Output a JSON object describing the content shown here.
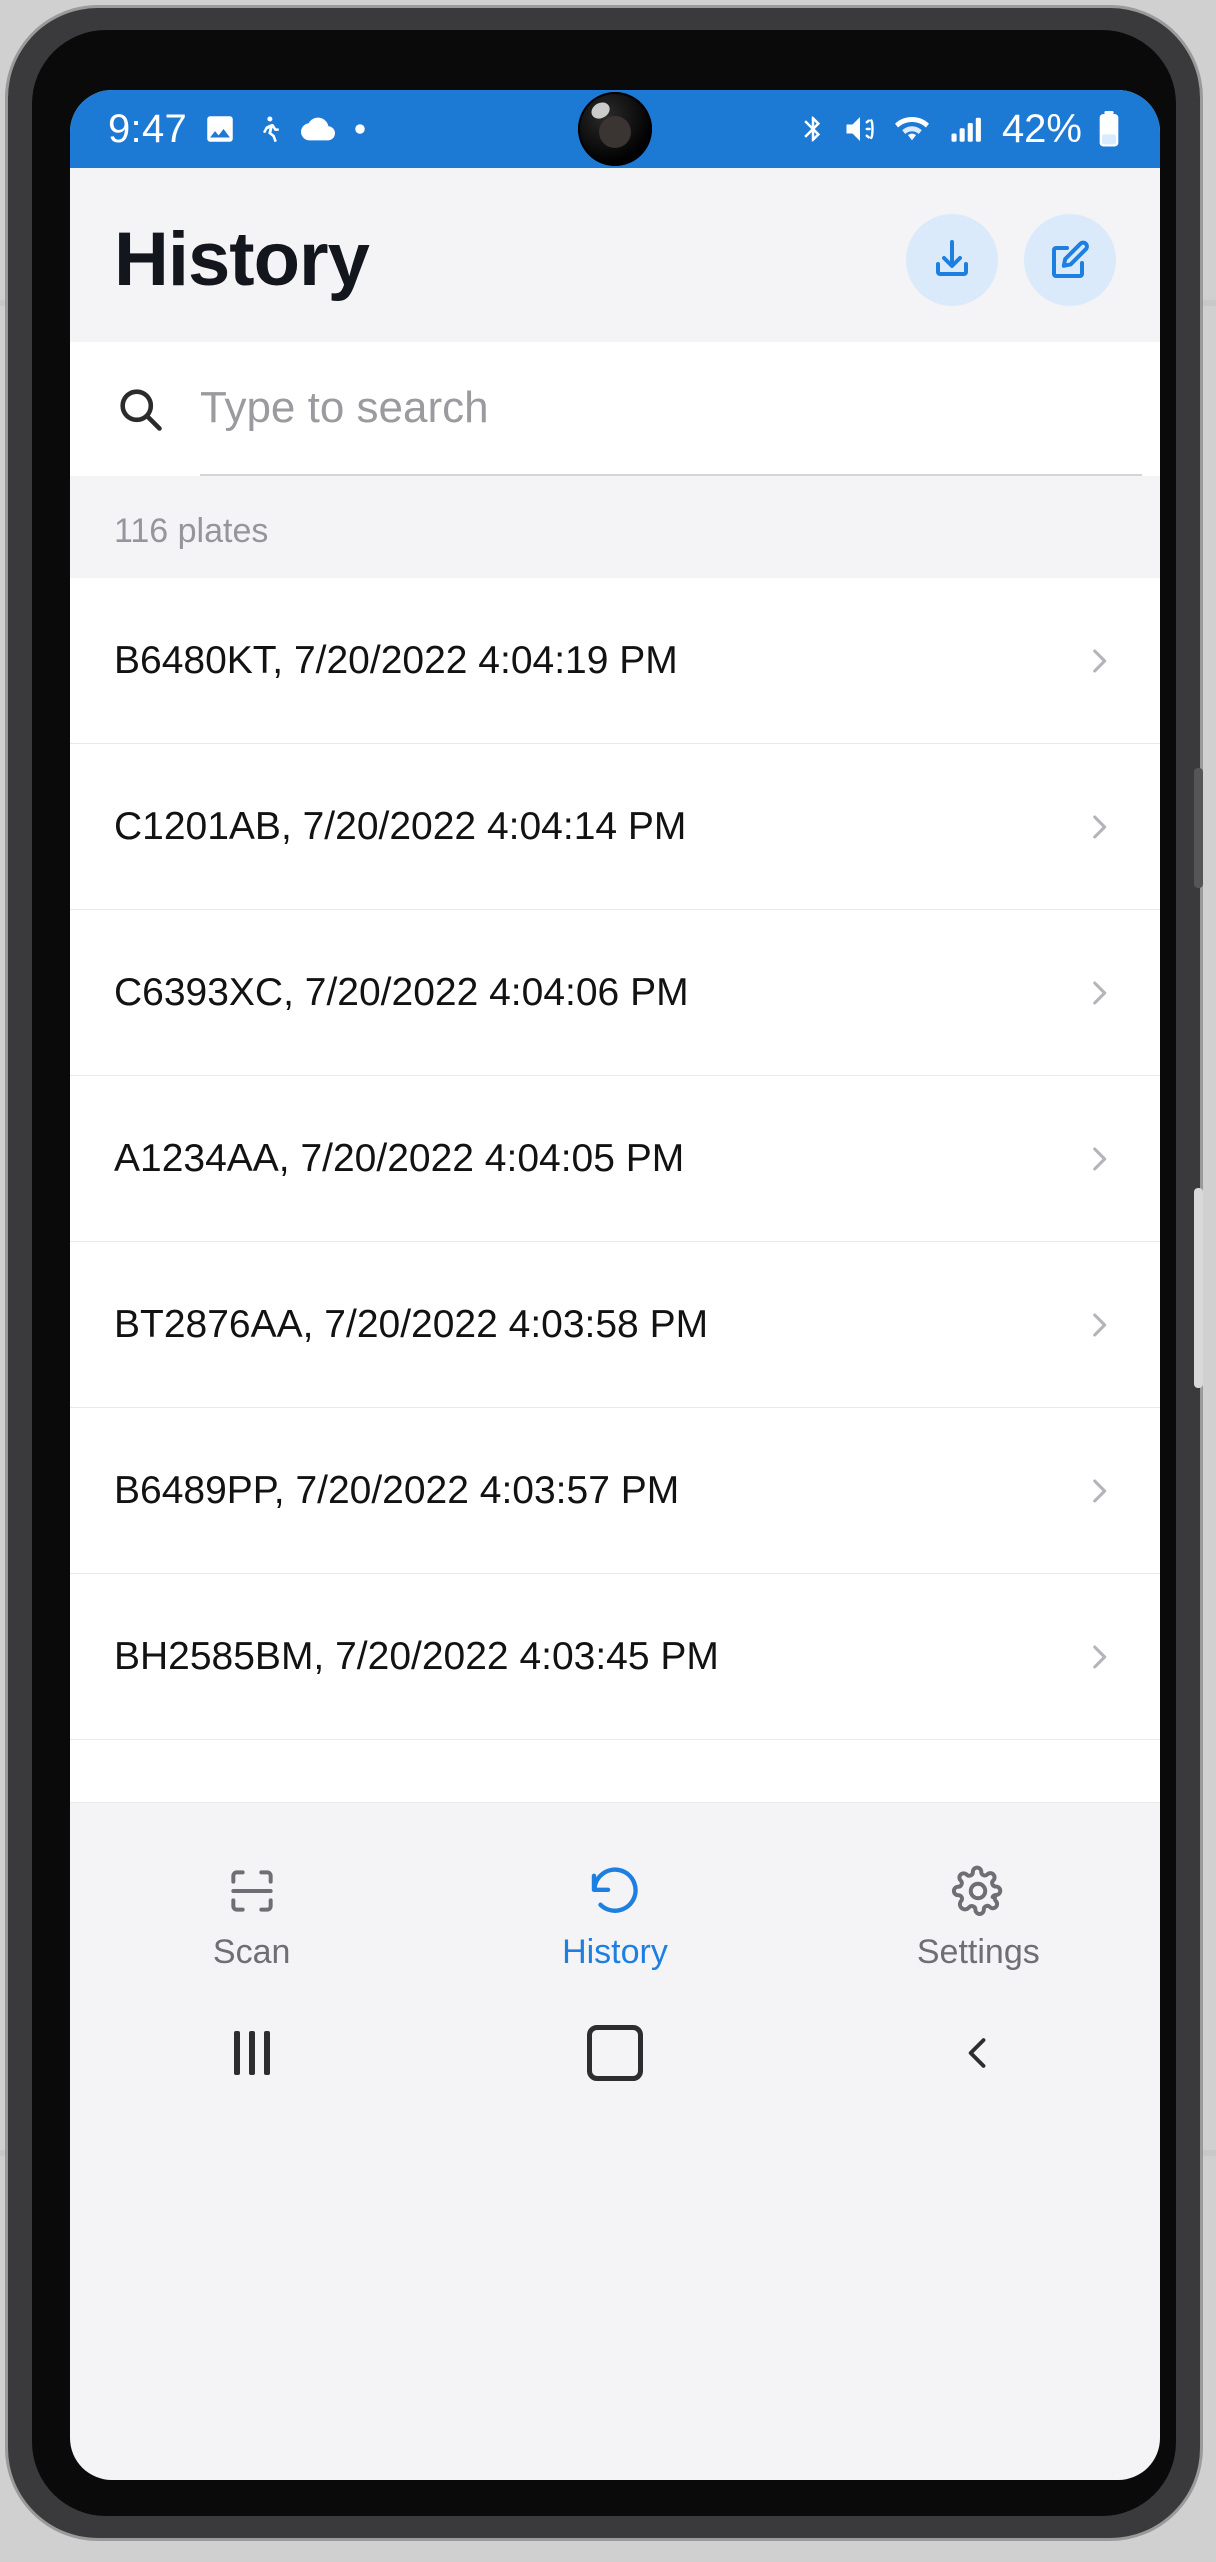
{
  "statusbar": {
    "time": "9:47",
    "battery_percent": "42%",
    "left_icons": [
      "photo-icon",
      "running-person-icon",
      "cloud-icon",
      "dot-icon"
    ],
    "right_icons": [
      "bluetooth-icon",
      "volume-mute-icon",
      "wifi-icon",
      "cellular-signal-icon",
      "battery-icon"
    ],
    "background": "#1c79d4"
  },
  "header": {
    "title": "History",
    "actions": [
      {
        "name": "download-button",
        "icon": "download-icon"
      },
      {
        "name": "edit-button",
        "icon": "edit-icon"
      }
    ],
    "accent": "#1d7fe0",
    "action_bg": "#dbeafb"
  },
  "search": {
    "icon": "search-icon",
    "placeholder": "Type to search",
    "value": ""
  },
  "list": {
    "count_label": "116 plates",
    "chevron_icon": "chevron-right-icon",
    "rows": [
      {
        "text": "B6480KT, 7/20/2022 4:04:19 PM"
      },
      {
        "text": "C1201AB, 7/20/2022 4:04:14 PM"
      },
      {
        "text": "C6393XC, 7/20/2022 4:04:06 PM"
      },
      {
        "text": "A1234AA, 7/20/2022 4:04:05 PM"
      },
      {
        "text": "BT2876AA, 7/20/2022 4:03:58 PM"
      },
      {
        "text": "B6489PP, 7/20/2022 4:03:57 PM"
      },
      {
        "text": "BH2585BM, 7/20/2022 4:03:45 PM"
      }
    ]
  },
  "bottomnav": {
    "items": [
      {
        "label": "Scan",
        "icon": "scan-frame-icon",
        "active": false
      },
      {
        "label": "History",
        "icon": "history-refresh-icon",
        "active": true
      },
      {
        "label": "Settings",
        "icon": "gear-icon",
        "active": false
      }
    ]
  },
  "sysnav": {
    "recents": "recents-icon",
    "home": "home-icon",
    "back": "back-icon"
  }
}
